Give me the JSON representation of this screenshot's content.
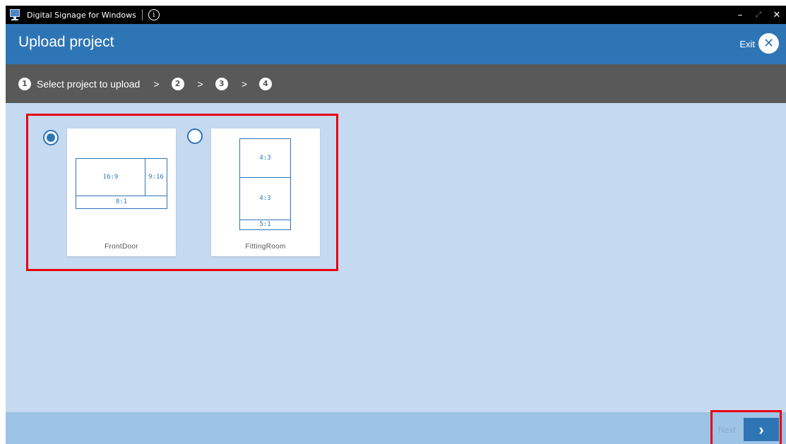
{
  "window": {
    "title": "Digital Signage for Windows",
    "info_glyph": "i",
    "controls": {
      "minimize": "–",
      "maximize": "⤢",
      "close": "✕"
    }
  },
  "header": {
    "title": "Upload project",
    "exit_label": "Exit",
    "exit_glyph": "✕"
  },
  "steps": {
    "items": [
      {
        "number": "1",
        "label": "Select project to upload",
        "active": true
      },
      {
        "number": "2"
      },
      {
        "number": "3"
      },
      {
        "number": "4"
      }
    ],
    "chevron": ">"
  },
  "projects": [
    {
      "name": "FrontDoor",
      "selected": true,
      "zones": [
        "16:9",
        "9:16",
        "8:1"
      ]
    },
    {
      "name": "FittingRoom",
      "selected": false,
      "zones": [
        "4:3",
        "4:3",
        "5:1"
      ]
    }
  ],
  "footer": {
    "next_label": "Next",
    "next_glyph": "›"
  },
  "colors": {
    "accent": "#2e75b6",
    "highlight": "#e8000b",
    "content_bg": "#c5d9f1",
    "stepbar_bg": "#595959"
  }
}
